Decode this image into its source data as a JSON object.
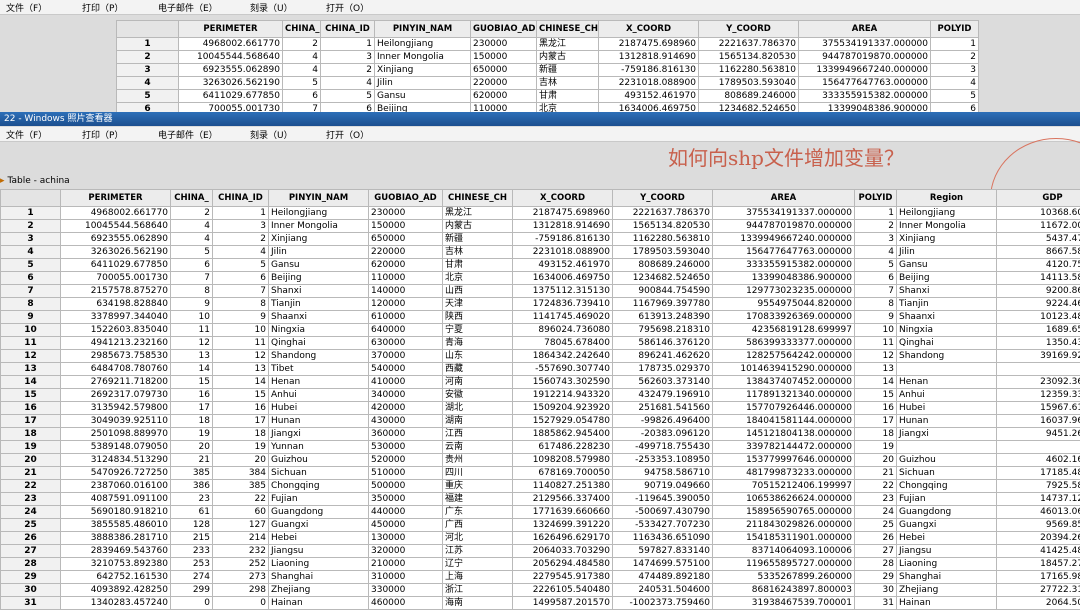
{
  "top_window": {
    "menu": [
      "文件（F）",
      "打印（P）",
      "电子邮件（E）",
      "刻录（U）",
      "打开（O）"
    ],
    "columns": [
      "PERIMETER",
      "CHINA_",
      "CHINA_ID",
      "PINYIN_NAM",
      "GUOBIAO_AD",
      "CHINESE_CH",
      "X_COORD",
      "Y_COORD",
      "AREA",
      "POLYID"
    ],
    "rows": [
      [
        "1",
        "4968002.661770",
        "2",
        "1",
        "Heilongjiang",
        "230000",
        "黑龙江",
        "2187475.698960",
        "2221637.786370",
        "375534191337.000000",
        "1"
      ],
      [
        "2",
        "10045544.568640",
        "4",
        "3",
        "Inner Mongolia",
        "150000",
        "内蒙古",
        "1312818.914690",
        "1565134.820530",
        "944787019870.000000",
        "2"
      ],
      [
        "3",
        "6923555.062890",
        "4",
        "2",
        "Xinjiang",
        "650000",
        "新疆",
        "-759186.816130",
        "1162280.563810",
        "1339949667240.000000",
        "3"
      ],
      [
        "4",
        "3263026.562190",
        "5",
        "4",
        "Jilin",
        "220000",
        "吉林",
        "2231018.088900",
        "1789503.593040",
        "156477647763.000000",
        "4"
      ],
      [
        "5",
        "6411029.677850",
        "6",
        "5",
        "Gansu",
        "620000",
        "甘肃",
        "493152.461970",
        "808689.246000",
        "333355915382.000000",
        "5"
      ],
      [
        "6",
        "700055.001730",
        "7",
        "6",
        "Beijing",
        "110000",
        "北京",
        "1634006.469750",
        "1234682.524650",
        "13399048386.900000",
        "6"
      ]
    ]
  },
  "viewer_title": "22 - Windows 照片查看器",
  "menu": [
    "文件（F）",
    "打印（P）",
    "电子邮件（E）",
    "刻录（U）",
    "打开（O）"
  ],
  "table_label": "Table - achina",
  "overlay_text": "如何向shp文件增加变量？",
  "columns": [
    "PERIMETER",
    "CHINA_",
    "CHINA_ID",
    "PINYIN_NAM",
    "GUOBIAO_AD",
    "CHINESE_CH",
    "X_COORD",
    "Y_COORD",
    "AREA",
    "POLYID",
    "Region",
    "GDP"
  ],
  "rows": [
    [
      "1",
      "4968002.661770",
      "2",
      "1",
      "Heilongjiang",
      "230000",
      "黑龙江",
      "2187475.698960",
      "2221637.786370",
      "375534191337.000000",
      "1",
      "Heilongjiang",
      "10368.600000"
    ],
    [
      "2",
      "10045544.568640",
      "4",
      "3",
      "Inner Mongolia",
      "150000",
      "内蒙古",
      "1312818.914690",
      "1565134.820530",
      "944787019870.000000",
      "2",
      "Inner Mongolia",
      "11672.000000"
    ],
    [
      "3",
      "6923555.062890",
      "4",
      "2",
      "Xinjiang",
      "650000",
      "新疆",
      "-759186.816130",
      "1162280.563810",
      "1339949667240.000000",
      "3",
      "Xinjiang",
      "5437.470000"
    ],
    [
      "4",
      "3263026.562190",
      "5",
      "4",
      "Jilin",
      "220000",
      "吉林",
      "2231018.088900",
      "1789503.593040",
      "156477647763.000000",
      "4",
      "Jilin",
      "8667.580000"
    ],
    [
      "5",
      "6411029.677850",
      "6",
      "5",
      "Gansu",
      "620000",
      "甘肃",
      "493152.461970",
      "808689.246000",
      "333355915382.000000",
      "5",
      "Gansu",
      "4120.750000"
    ],
    [
      "6",
      "700055.001730",
      "7",
      "6",
      "Beijing",
      "110000",
      "北京",
      "1634006.469750",
      "1234682.524650",
      "13399048386.900000",
      "6",
      "Beijing",
      "14113.580000"
    ],
    [
      "7",
      "2157578.875270",
      "8",
      "7",
      "Shanxi",
      "140000",
      "山西",
      "1375112.315130",
      "900844.754590",
      "129773023235.000000",
      "7",
      "Shanxi",
      "9200.860000"
    ],
    [
      "8",
      "634198.828840",
      "9",
      "8",
      "Tianjin",
      "120000",
      "天津",
      "1724836.739410",
      "1167969.397780",
      "9554975044.820000",
      "8",
      "Tianjin",
      "9224.460000"
    ],
    [
      "9",
      "3378997.344040",
      "10",
      "9",
      "Shaanxi",
      "610000",
      "陕西",
      "1141745.469020",
      "613913.248390",
      "170833926369.000000",
      "9",
      "Shaanxi",
      "10123.480000"
    ],
    [
      "10",
      "1522603.835040",
      "11",
      "10",
      "Ningxia",
      "640000",
      "宁夏",
      "896024.736080",
      "795698.218310",
      "42356819128.699997",
      "10",
      "Ningxia",
      "1689.650000"
    ],
    [
      "11",
      "4941213.232160",
      "12",
      "11",
      "Qinghai",
      "630000",
      "青海",
      "78045.678400",
      "586146.376120",
      "586399333377.000000",
      "11",
      "Qinghai",
      "1350.430000"
    ],
    [
      "12",
      "2985673.758530",
      "13",
      "12",
      "Shandong",
      "370000",
      "山东",
      "1864342.242640",
      "896241.462620",
      "128257564242.000000",
      "12",
      "Shandong",
      "39169.920000"
    ],
    [
      "13",
      "6484708.780760",
      "14",
      "13",
      "Tibet",
      "540000",
      "西藏",
      "-557690.307740",
      "178735.029370",
      "1014639415290.000000",
      "13",
      "",
      ""
    ],
    [
      "14",
      "2769211.718200",
      "15",
      "14",
      "Henan",
      "410000",
      "河南",
      "1560743.302590",
      "562603.373140",
      "138437407452.000000",
      "14",
      "Henan",
      "23092.360000"
    ],
    [
      "15",
      "2692317.079730",
      "16",
      "15",
      "Anhui",
      "340000",
      "安徽",
      "1912214.943320",
      "432479.196910",
      "117891321340.000000",
      "15",
      "Anhui",
      "12359.330000"
    ],
    [
      "16",
      "3135942.579800",
      "17",
      "16",
      "Hubei",
      "420000",
      "湖北",
      "1509204.923920",
      "251681.541560",
      "157707926446.000000",
      "16",
      "Hubei",
      "15967.610000"
    ],
    [
      "17",
      "3049039.925110",
      "18",
      "17",
      "Hunan",
      "430000",
      "湖南",
      "1527929.054780",
      "-99826.496400",
      "184041581144.000000",
      "17",
      "Hunan",
      "16037.960000"
    ],
    [
      "18",
      "2501098.889970",
      "19",
      "18",
      "Jiangxi",
      "360000",
      "江西",
      "1885862.945400",
      "-20383.096120",
      "145121804138.000000",
      "18",
      "Jiangxi",
      "9451.260000"
    ],
    [
      "19",
      "5389148.079050",
      "20",
      "19",
      "Yunnan",
      "530000",
      "云南",
      "617486.228230",
      "-499718.755430",
      "339782144472.000000",
      "19",
      "",
      ""
    ],
    [
      "20",
      "3124834.513290",
      "21",
      "20",
      "Guizhou",
      "520000",
      "贵州",
      "1098208.579980",
      "-253353.108950",
      "153779997646.000000",
      "20",
      "Guizhou",
      "4602.160000"
    ],
    [
      "21",
      "5470926.727250",
      "385",
      "384",
      "Sichuan",
      "510000",
      "四川",
      "678169.700050",
      "94758.586710",
      "481799873233.000000",
      "21",
      "Sichuan",
      "17185.480000"
    ],
    [
      "22",
      "2387060.016100",
      "386",
      "385",
      "Chongqing",
      "500000",
      "重庆",
      "1140827.251380",
      "90719.049660",
      "70515212406.199997",
      "22",
      "Chongqing",
      "7925.580000"
    ],
    [
      "23",
      "4087591.091100",
      "23",
      "22",
      "Fujian",
      "350000",
      "福建",
      "2129566.337400",
      "-119645.390050",
      "106538626624.000000",
      "23",
      "Fujian",
      "14737.120000"
    ],
    [
      "24",
      "5690180.918210",
      "61",
      "60",
      "Guangdong",
      "440000",
      "广东",
      "1771639.660660",
      "-500697.430790",
      "158956590765.000000",
      "24",
      "Guangdong",
      "46013.060000"
    ],
    [
      "25",
      "3855585.486010",
      "128",
      "127",
      "Guangxi",
      "450000",
      "广西",
      "1324699.391220",
      "-533427.707230",
      "211843029826.000000",
      "25",
      "Guangxi",
      "9569.850000"
    ],
    [
      "26",
      "3888386.281710",
      "215",
      "214",
      "Hebei",
      "130000",
      "河北",
      "1626496.629170",
      "1163436.651090",
      "154185311901.000000",
      "26",
      "Hebei",
      "20394.260000"
    ],
    [
      "27",
      "2839469.543760",
      "233",
      "232",
      "Jiangsu",
      "320000",
      "江苏",
      "2064033.703290",
      "597827.833140",
      "83714064093.100006",
      "27",
      "Jiangsu",
      "41425.480000"
    ],
    [
      "28",
      "3210753.892380",
      "253",
      "252",
      "Liaoning",
      "210000",
      "辽宁",
      "2056294.484580",
      "1474699.575100",
      "119655895727.000000",
      "28",
      "Liaoning",
      "18457.270000"
    ],
    [
      "29",
      "642752.161530",
      "274",
      "273",
      "Shanghai",
      "310000",
      "上海",
      "2279545.917380",
      "474489.892180",
      "5335267899.260000",
      "29",
      "Shanghai",
      "17165.980000"
    ],
    [
      "30",
      "4093892.428250",
      "299",
      "298",
      "Zhejiang",
      "330000",
      "浙江",
      "2226105.540480",
      "240531.504600",
      "86816243897.800003",
      "30",
      "Zhejiang",
      "27722.310000"
    ],
    [
      "31",
      "1340283.457240",
      "0",
      "0",
      "Hainan",
      "460000",
      "海南",
      "1499587.201570",
      "-1002373.759460",
      "31938467539.700001",
      "31",
      "Hainan",
      "2064.500000"
    ]
  ]
}
